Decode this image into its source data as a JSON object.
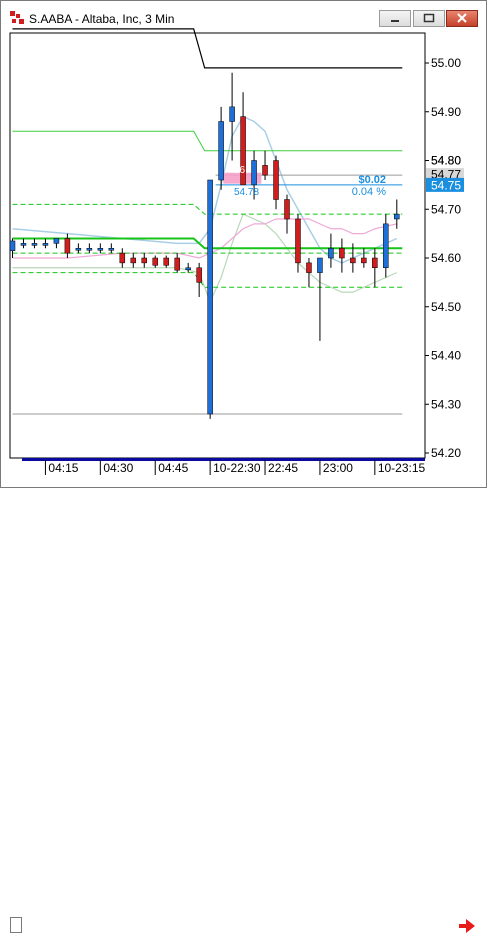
{
  "window": {
    "title": "S.AABA - Altaba, Inc, 3 Min",
    "buttons": {
      "minimize": "minimize-icon",
      "maximize": "maximize-icon",
      "close": "close-icon"
    }
  },
  "colors": {
    "up": "#1f6fd8",
    "down": "#d01e1e",
    "upper_band": "#3ccf3c",
    "mid_line": "#19c419",
    "lower_band": "#19c419",
    "bollinger": "#a9cfe6",
    "ma_pink": "#f0a8d8",
    "ma_gray": "#b8d8b8",
    "level_black": "#000000",
    "level_gray": "#9a9a9a",
    "label_blue": "#1a8fe0",
    "current_price_bg": "#1a8fe0",
    "highlight_pink": "#f5a0c8",
    "time_bar": "#0a0aa0"
  },
  "price_labels": [
    {
      "id": "p8080",
      "text": "54.80",
      "value": 54.8
    },
    {
      "id": "p5477",
      "text": "54.77",
      "value": 54.77
    },
    {
      "id": "p5475",
      "text": "54.75",
      "value": 54.75
    }
  ],
  "annotation": {
    "change": "$0.02",
    "change_pct": "0.04 %",
    "highlight_price": "54.78",
    "highlight_prefix": "56"
  },
  "chart_data": {
    "type": "candlestick",
    "title": "S.AABA - Altaba, Inc, 3 Min",
    "y_ticks": [
      55.0,
      54.9,
      54.8,
      54.7,
      54.6,
      54.5,
      54.4,
      54.3,
      54.2
    ],
    "y_tick_labels": [
      "55.00",
      "54.90",
      "54.80",
      "54.70",
      "54.60",
      "54.50",
      "54.40",
      "54.30",
      "54.20"
    ],
    "ylim": [
      54.185,
      55.05
    ],
    "x_tick_labels": [
      "04:15",
      "04:30",
      "04:45",
      "10-22:30",
      "22:45",
      "23:00",
      "10-23:15"
    ],
    "x_tick_positions": [
      3.5,
      8.5,
      13.5,
      18.5,
      23.5,
      28.5,
      33.5
    ],
    "candles": [
      {
        "i": 0,
        "o": 54.615,
        "h": 54.64,
        "l": 54.6,
        "c": 54.635
      },
      {
        "i": 1,
        "o": 54.63,
        "h": 54.64,
        "l": 54.62,
        "c": 54.63
      },
      {
        "i": 2,
        "o": 54.63,
        "h": 54.64,
        "l": 54.62,
        "c": 54.63
      },
      {
        "i": 3,
        "o": 54.63,
        "h": 54.64,
        "l": 54.62,
        "c": 54.63
      },
      {
        "i": 4,
        "o": 54.63,
        "h": 54.64,
        "l": 54.62,
        "c": 54.64
      },
      {
        "i": 5,
        "o": 54.64,
        "h": 54.65,
        "l": 54.6,
        "c": 54.61
      },
      {
        "i": 6,
        "o": 54.62,
        "h": 54.63,
        "l": 54.61,
        "c": 54.62
      },
      {
        "i": 7,
        "o": 54.62,
        "h": 54.63,
        "l": 54.61,
        "c": 54.62
      },
      {
        "i": 8,
        "o": 54.62,
        "h": 54.63,
        "l": 54.61,
        "c": 54.62
      },
      {
        "i": 9,
        "o": 54.62,
        "h": 54.63,
        "l": 54.61,
        "c": 54.62
      },
      {
        "i": 10,
        "o": 54.61,
        "h": 54.62,
        "l": 54.58,
        "c": 54.59
      },
      {
        "i": 11,
        "o": 54.6,
        "h": 54.61,
        "l": 54.58,
        "c": 54.59
      },
      {
        "i": 12,
        "o": 54.6,
        "h": 54.61,
        "l": 54.58,
        "c": 54.59
      },
      {
        "i": 13,
        "o": 54.6,
        "h": 54.605,
        "l": 54.58,
        "c": 54.585
      },
      {
        "i": 14,
        "o": 54.6,
        "h": 54.605,
        "l": 54.58,
        "c": 54.585
      },
      {
        "i": 15,
        "o": 54.6,
        "h": 54.61,
        "l": 54.57,
        "c": 54.575
      },
      {
        "i": 16,
        "o": 54.58,
        "h": 54.59,
        "l": 54.57,
        "c": 54.58
      },
      {
        "i": 17,
        "o": 54.58,
        "h": 54.59,
        "l": 54.52,
        "c": 54.55
      },
      {
        "i": 18,
        "o": 54.28,
        "h": 54.76,
        "l": 54.27,
        "c": 54.76
      },
      {
        "i": 19,
        "o": 54.76,
        "h": 54.91,
        "l": 54.74,
        "c": 54.88
      },
      {
        "i": 20,
        "o": 54.88,
        "h": 54.98,
        "l": 54.8,
        "c": 54.91
      },
      {
        "i": 21,
        "o": 54.89,
        "h": 54.94,
        "l": 54.78,
        "c": 54.75
      },
      {
        "i": 22,
        "o": 54.75,
        "h": 54.82,
        "l": 54.72,
        "c": 54.8
      },
      {
        "i": 23,
        "o": 54.79,
        "h": 54.82,
        "l": 54.76,
        "c": 54.77
      },
      {
        "i": 24,
        "o": 54.8,
        "h": 54.81,
        "l": 54.7,
        "c": 54.72
      },
      {
        "i": 25,
        "o": 54.72,
        "h": 54.73,
        "l": 54.65,
        "c": 54.68
      },
      {
        "i": 26,
        "o": 54.68,
        "h": 54.69,
        "l": 54.57,
        "c": 54.59
      },
      {
        "i": 27,
        "o": 54.59,
        "h": 54.6,
        "l": 54.54,
        "c": 54.57
      },
      {
        "i": 28,
        "o": 54.57,
        "h": 54.6,
        "l": 54.43,
        "c": 54.6
      },
      {
        "i": 29,
        "o": 54.6,
        "h": 54.65,
        "l": 54.58,
        "c": 54.62
      },
      {
        "i": 30,
        "o": 54.62,
        "h": 54.64,
        "l": 54.57,
        "c": 54.6
      },
      {
        "i": 31,
        "o": 54.6,
        "h": 54.63,
        "l": 54.57,
        "c": 54.59
      },
      {
        "i": 32,
        "o": 54.6,
        "h": 54.62,
        "l": 54.58,
        "c": 54.59
      },
      {
        "i": 33,
        "o": 54.6,
        "h": 54.62,
        "l": 54.54,
        "c": 54.58
      },
      {
        "i": 34,
        "o": 54.58,
        "h": 54.69,
        "l": 54.56,
        "c": 54.67
      },
      {
        "i": 35,
        "o": 54.68,
        "h": 54.72,
        "l": 54.66,
        "c": 54.69
      }
    ],
    "lines": {
      "black_top": [
        [
          0,
          55.07
        ],
        [
          16.5,
          55.07
        ],
        [
          17.5,
          54.99
        ],
        [
          35.5,
          54.99
        ]
      ],
      "upper_band": [
        [
          0,
          54.86
        ],
        [
          16.5,
          54.86
        ],
        [
          17.5,
          54.82
        ],
        [
          35.5,
          54.82
        ]
      ],
      "mid_line": [
        [
          0,
          54.64
        ],
        [
          16.5,
          54.64
        ],
        [
          17.5,
          54.62
        ],
        [
          35.5,
          54.62
        ]
      ],
      "lower_band": [
        [
          0,
          54.57
        ],
        [
          16.5,
          54.57
        ],
        [
          17.5,
          54.54
        ],
        [
          35.5,
          54.54
        ]
      ],
      "dashed_upper": [
        [
          0,
          54.71
        ],
        [
          16.5,
          54.71
        ],
        [
          17.5,
          54.69
        ],
        [
          35.5,
          54.69
        ]
      ],
      "dashed_lower": [
        [
          0,
          54.61
        ],
        [
          35.5,
          54.61
        ]
      ],
      "gray_bottom": [
        [
          0,
          54.28
        ],
        [
          35.5,
          54.28
        ]
      ],
      "blue_level": [
        [
          18.5,
          54.75
        ],
        [
          35.5,
          54.75
        ]
      ],
      "gray_level": [
        [
          18.5,
          54.77
        ],
        [
          35.5,
          54.77
        ]
      ],
      "bollinger_upper": [
        [
          0,
          54.66
        ],
        [
          5,
          54.65
        ],
        [
          10,
          54.64
        ],
        [
          15,
          54.63
        ],
        [
          17,
          54.63
        ],
        [
          18,
          54.66
        ],
        [
          19,
          54.75
        ],
        [
          20,
          54.85
        ],
        [
          21,
          54.89
        ],
        [
          22,
          54.88
        ],
        [
          23,
          54.86
        ],
        [
          24,
          54.8
        ],
        [
          25,
          54.74
        ],
        [
          26,
          54.7
        ],
        [
          27,
          54.66
        ],
        [
          28,
          54.62
        ],
        [
          29,
          54.6
        ],
        [
          30,
          54.59
        ],
        [
          31,
          54.6
        ],
        [
          32,
          54.61
        ],
        [
          33,
          54.62
        ],
        [
          35,
          54.64
        ]
      ],
      "bollinger_lower": [
        [
          0,
          54.58
        ],
        [
          5,
          54.58
        ],
        [
          10,
          54.58
        ],
        [
          15,
          54.58
        ],
        [
          17,
          54.57
        ],
        [
          18,
          54.51
        ],
        [
          19,
          54.56
        ],
        [
          20,
          54.63
        ],
        [
          21,
          54.69
        ],
        [
          22,
          54.68
        ],
        [
          23,
          54.67
        ],
        [
          24,
          54.65
        ],
        [
          25,
          54.62
        ],
        [
          26,
          54.59
        ],
        [
          27,
          54.57
        ],
        [
          28,
          54.55
        ],
        [
          29,
          54.54
        ],
        [
          30,
          54.53
        ],
        [
          31,
          54.53
        ],
        [
          32,
          54.54
        ],
        [
          33,
          54.55
        ],
        [
          35,
          54.57
        ]
      ],
      "ma_pink": [
        [
          0,
          54.6
        ],
        [
          5,
          54.6
        ],
        [
          10,
          54.61
        ],
        [
          15,
          54.61
        ],
        [
          17,
          54.6
        ],
        [
          18,
          54.61
        ],
        [
          19,
          54.62
        ],
        [
          20,
          54.64
        ],
        [
          21,
          54.66
        ],
        [
          22,
          54.67
        ],
        [
          23,
          54.67
        ],
        [
          24,
          54.68
        ],
        [
          25,
          54.68
        ],
        [
          26,
          54.68
        ],
        [
          27,
          54.68
        ],
        [
          28,
          54.67
        ],
        [
          29,
          54.66
        ],
        [
          30,
          54.66
        ],
        [
          31,
          54.65
        ],
        [
          32,
          54.65
        ],
        [
          33,
          54.66
        ],
        [
          35,
          54.67
        ]
      ]
    }
  }
}
